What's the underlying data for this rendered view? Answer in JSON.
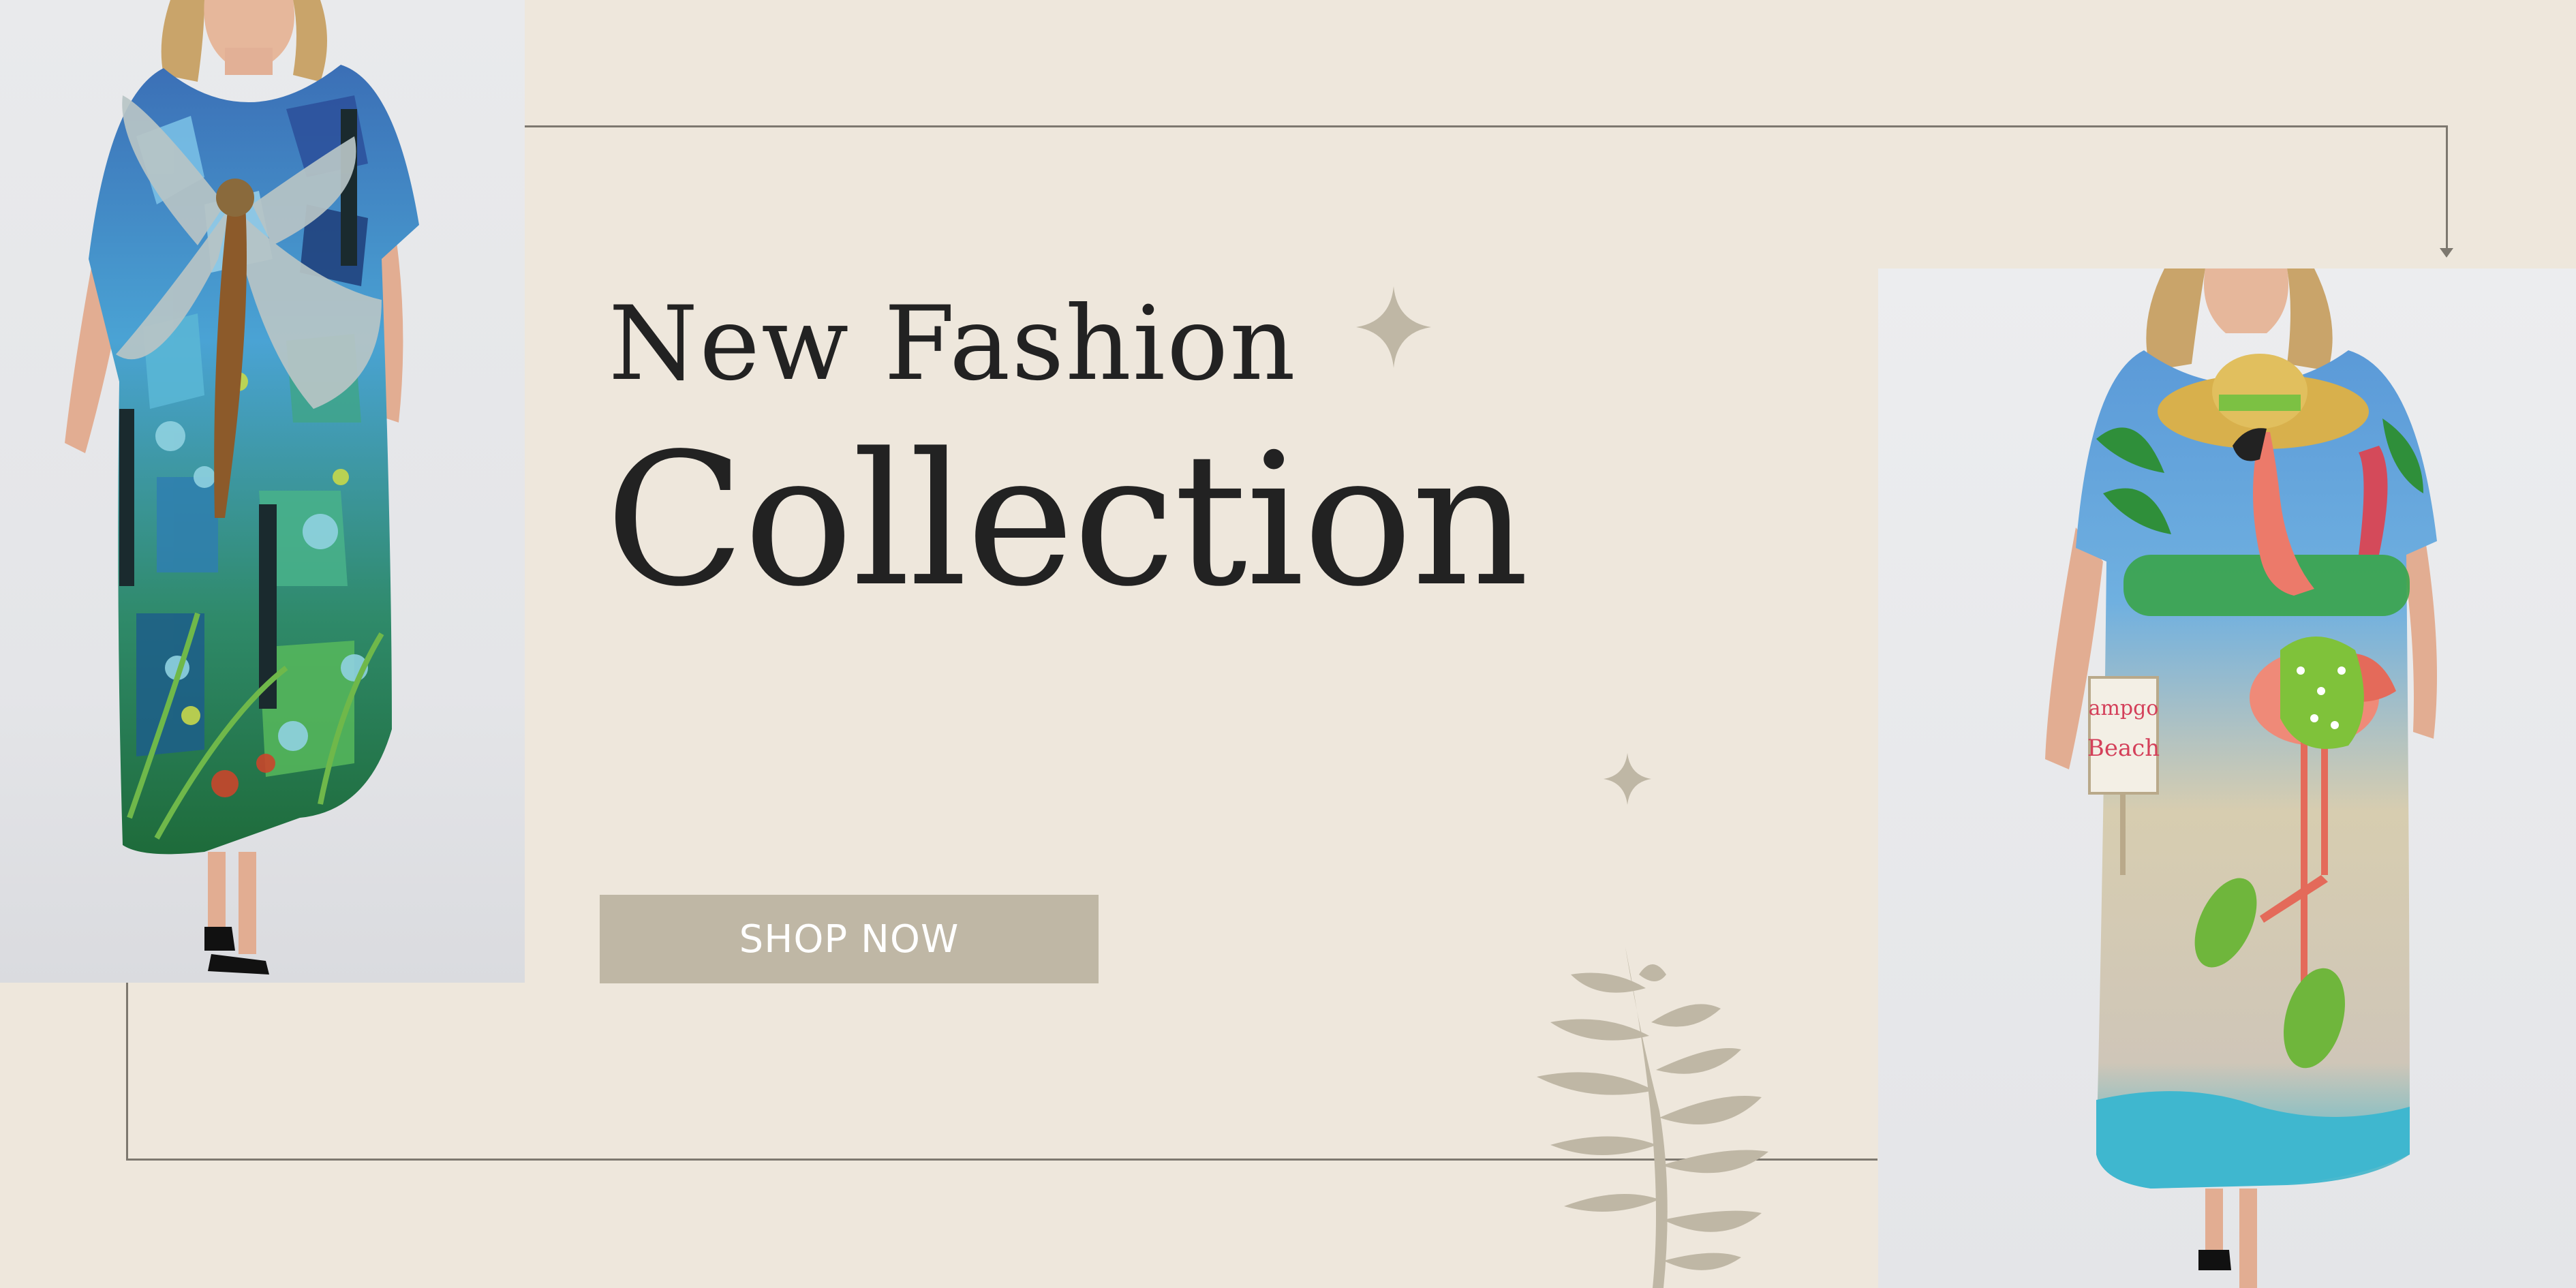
{
  "headline": {
    "line1": "New Fashion",
    "line2": "Collection"
  },
  "cta": {
    "label": "SHOP NOW"
  },
  "products": {
    "left": {
      "icon": "dragonfly-print-dress-photo"
    },
    "right": {
      "icon": "flamingo-beach-print-dress-photo",
      "print_text": "Flamingo Beach"
    }
  },
  "colors": {
    "background": "#eee7dc",
    "text": "#222222",
    "button": "#bfb7a5",
    "button_text": "#ffffff",
    "accent": "#bfb7a5",
    "frame_line": "#7d786f"
  }
}
